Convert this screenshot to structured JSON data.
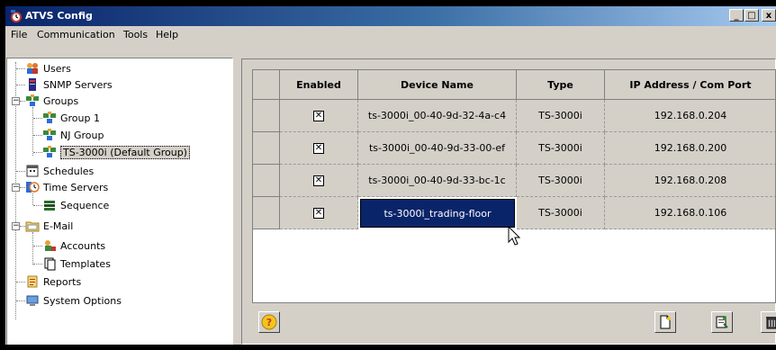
{
  "window": {
    "title": "ATVS Config"
  },
  "title_buttons": {
    "minimize": "_",
    "maximize": "□",
    "close": "x"
  },
  "menu": [
    "File",
    "Communication",
    "Tools",
    "Help"
  ],
  "tree": [
    {
      "label": "Users",
      "icon": "users-icon"
    },
    {
      "label": "SNMP Servers",
      "icon": "snmp-server-icon"
    },
    {
      "label": "Groups",
      "icon": "groups-icon"
    },
    {
      "label": "Group 1",
      "icon": "group-icon"
    },
    {
      "label": "NJ Group",
      "icon": "group-icon"
    },
    {
      "label": "TS-3000i (Default Group)",
      "icon": "group-icon",
      "selected": true
    },
    {
      "label": "Schedules",
      "icon": "calendar-icon"
    },
    {
      "label": "Time Servers",
      "icon": "clock-icon"
    },
    {
      "label": "Sequence",
      "icon": "sequence-icon"
    },
    {
      "label": "E-Mail",
      "icon": "folder-icon"
    },
    {
      "label": "Accounts",
      "icon": "accounts-icon"
    },
    {
      "label": "Templates",
      "icon": "templates-icon"
    },
    {
      "label": "Reports",
      "icon": "reports-icon"
    },
    {
      "label": "System Options",
      "icon": "system-options-icon"
    }
  ],
  "table": {
    "columns": [
      "Enabled",
      "Device Name",
      "Type",
      "IP Address / Com Port"
    ],
    "rows": [
      {
        "enabled": true,
        "device": "ts-3000i_00-40-9d-32-4a-c4",
        "type": "TS-3000i",
        "ip": "192.168.0.204"
      },
      {
        "enabled": true,
        "device": "ts-3000i_00-40-9d-33-00-ef",
        "type": "TS-3000i",
        "ip": "192.168.0.200"
      },
      {
        "enabled": true,
        "device": "ts-3000i_00-40-9d-33-bc-1c",
        "type": "TS-3000i",
        "ip": "192.168.0.208"
      },
      {
        "enabled": true,
        "device": "ts-3000i_trading-floor",
        "type": "TS-3000i",
        "ip": "192.168.0.106",
        "editing": true
      }
    ],
    "checkbox_mark": "✕"
  },
  "buttons": {
    "help": "?"
  }
}
